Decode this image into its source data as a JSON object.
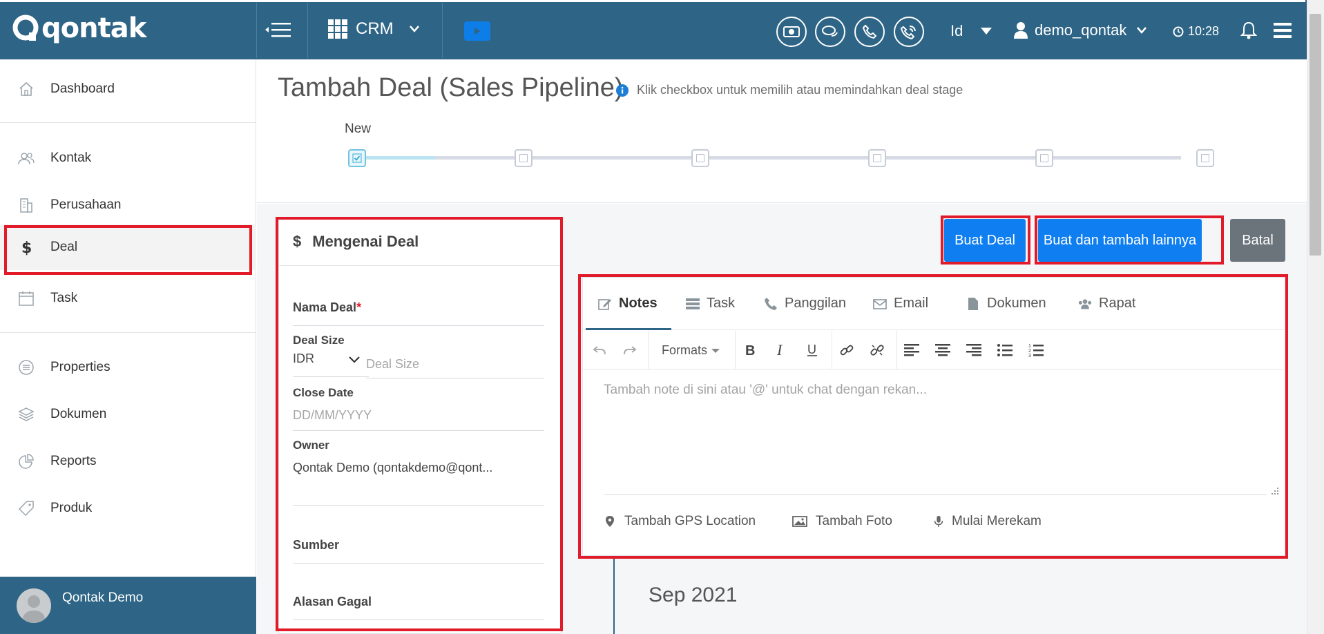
{
  "app": {
    "logo_text": "qontak",
    "module": "CRM",
    "language": "Id",
    "username": "demo_qontak",
    "time": "10:28"
  },
  "sidebar": {
    "items": [
      {
        "label": "Dashboard",
        "icon": "home-icon"
      },
      {
        "label": "Kontak",
        "icon": "users-icon"
      },
      {
        "label": "Perusahaan",
        "icon": "building-icon"
      },
      {
        "label": "Deal",
        "icon": "dollar-icon"
      },
      {
        "label": "Task",
        "icon": "calendar-icon"
      },
      {
        "label": "Properties",
        "icon": "list-circle-icon"
      },
      {
        "label": "Dokumen",
        "icon": "layers-icon"
      },
      {
        "label": "Reports",
        "icon": "pie-chart-icon"
      },
      {
        "label": "Produk",
        "icon": "tag-icon"
      }
    ],
    "active": "Deal",
    "profile_name": "Qontak Demo"
  },
  "page": {
    "title": "Tambah Deal (Sales Pipeline)",
    "hint": "Klik checkbox untuk memilih atau memindahkan deal stage",
    "stage_first_label": "New"
  },
  "form": {
    "header": "Mengenai Deal",
    "nama_deal_label": "Nama Deal",
    "required_mark": "*",
    "deal_size_label": "Deal Size",
    "currency": "IDR",
    "deal_size_placeholder": "Deal Size",
    "close_date_label": "Close Date",
    "close_date_placeholder": "DD/MM/YYYY",
    "owner_label": "Owner",
    "owner_value": "Qontak Demo (qontakdemo@qont...",
    "sumber_label": "Sumber",
    "alasan_label": "Alasan Gagal"
  },
  "actions": {
    "create": "Buat Deal",
    "create_more": "Buat dan tambah lainnya",
    "cancel": "Batal"
  },
  "editor": {
    "tabs": [
      "Notes",
      "Task",
      "Panggilan",
      "Email",
      "Dokumen",
      "Rapat"
    ],
    "active_tab": "Notes",
    "formats_label": "Formats",
    "placeholder": "Tambah note di sini atau '@' untuk chat dengan rekan...",
    "extras": [
      "Tambah GPS Location",
      "Tambah Foto",
      "Mulai Merekam"
    ]
  },
  "timeline": {
    "month": "Sep 2021"
  },
  "colors": {
    "navbar": "#2e6586",
    "primary": "#0f7ef0",
    "highlight": "#e21b2b"
  }
}
